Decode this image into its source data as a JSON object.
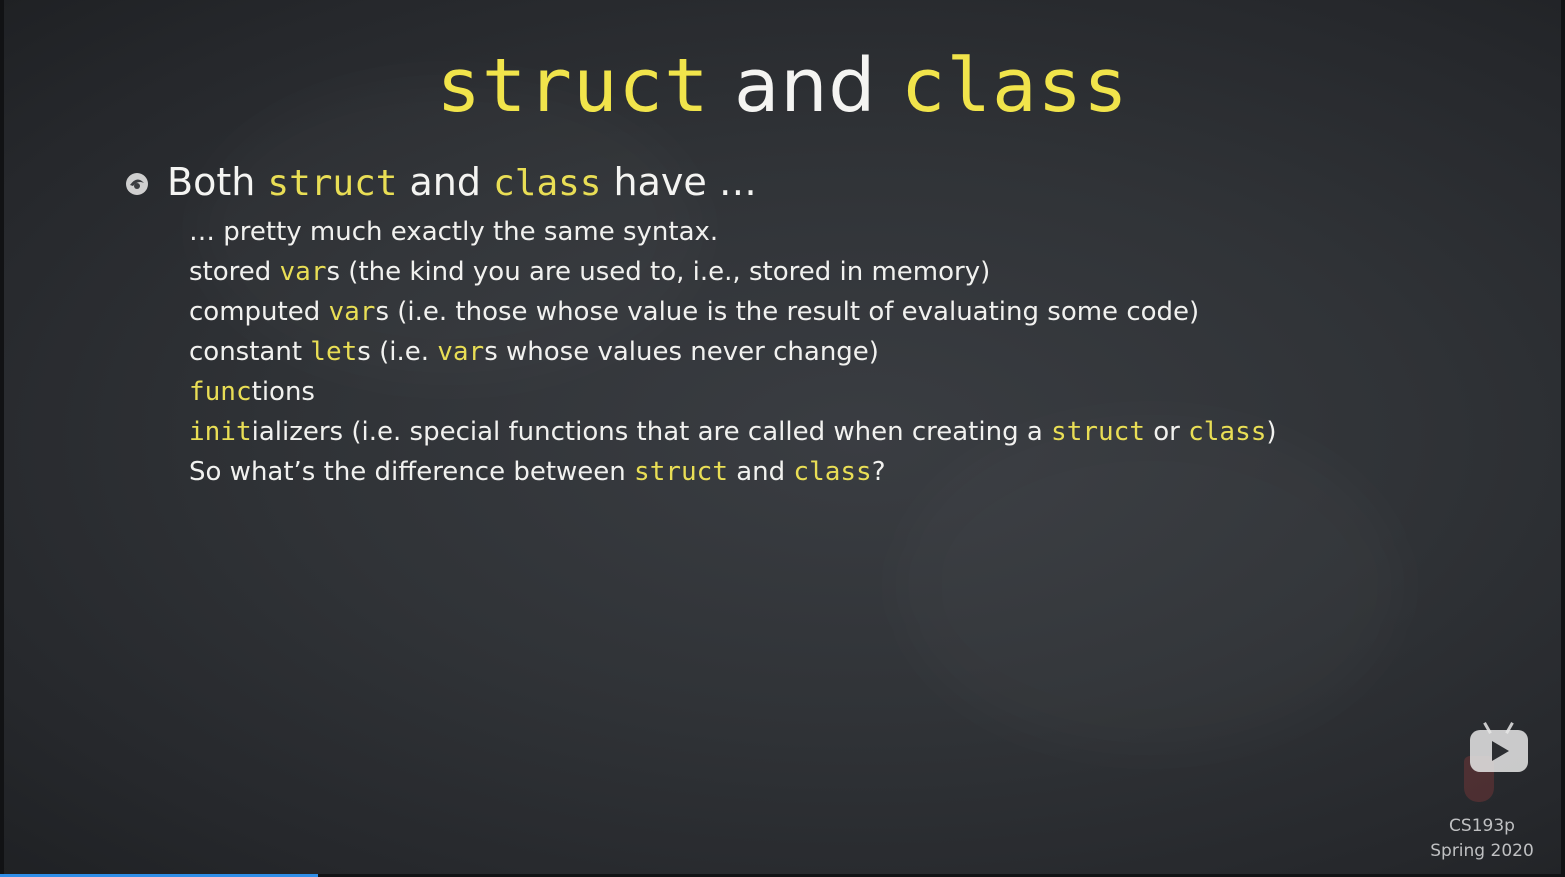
{
  "slide": {
    "title": [
      {
        "text": "struct",
        "code": true
      },
      {
        "text": " and ",
        "code": false
      },
      {
        "text": "class",
        "code": true
      }
    ],
    "bullet": [
      {
        "text": "Both ",
        "code": false
      },
      {
        "text": "struct",
        "code": true
      },
      {
        "text": " and ",
        "code": false
      },
      {
        "text": "class",
        "code": true
      },
      {
        "text": " have …",
        "code": false
      }
    ],
    "lines": [
      [
        {
          "text": "… pretty much exactly the same syntax.",
          "code": false
        }
      ],
      [
        {
          "text": "stored ",
          "code": false
        },
        {
          "text": "var",
          "code": true
        },
        {
          "text": "s (the kind you are used to, i.e., stored in memory)",
          "code": false
        }
      ],
      [
        {
          "text": "computed ",
          "code": false
        },
        {
          "text": "var",
          "code": true
        },
        {
          "text": "s (i.e. those whose value is the result of evaluating some code)",
          "code": false
        }
      ],
      [
        {
          "text": "constant ",
          "code": false
        },
        {
          "text": "let",
          "code": true
        },
        {
          "text": "s (i.e. ",
          "code": false
        },
        {
          "text": "var",
          "code": true
        },
        {
          "text": "s whose values never change)",
          "code": false
        }
      ],
      [
        {
          "text": "func",
          "code": true
        },
        {
          "text": "tions",
          "code": false
        }
      ],
      [
        {
          "text": "init",
          "code": true
        },
        {
          "text": "ializers (i.e. special functions that are called when creating a ",
          "code": false
        },
        {
          "text": "struct",
          "code": true
        },
        {
          "text": " or ",
          "code": false
        },
        {
          "text": "class",
          "code": true
        },
        {
          "text": ")",
          "code": false
        }
      ],
      [
        {
          "text": "So what’s the difference between ",
          "code": false
        },
        {
          "text": "struct",
          "code": true
        },
        {
          "text": " and ",
          "code": false
        },
        {
          "text": "class",
          "code": true
        },
        {
          "text": "?",
          "code": false
        }
      ]
    ]
  },
  "branding": {
    "course": "CS193p",
    "term": "Spring 2020"
  },
  "player": {
    "progress": 0.203,
    "icon": "video-play-icon"
  },
  "colors": {
    "code": "#e9de55",
    "text": "#f4f4f2",
    "progress": "#2f8ee8"
  }
}
